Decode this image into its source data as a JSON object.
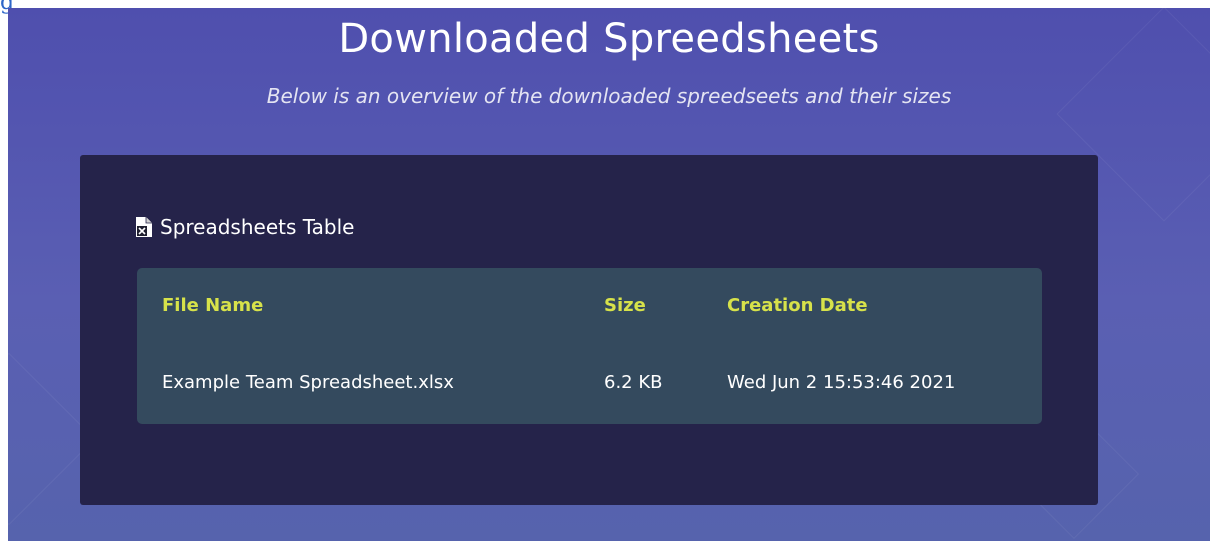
{
  "top_link": "g",
  "page": {
    "title": "Downloaded Spreedsheets",
    "subtitle": "Below is an overview of the downloaded spreedseets and their sizes"
  },
  "card": {
    "icon": "excel-file-icon",
    "title": "Spreadsheets Table"
  },
  "table": {
    "headers": [
      "File Name",
      "Size",
      "Creation Date"
    ],
    "rows": [
      [
        "Example Team Spreadsheet.xlsx",
        "6.2 KB",
        "Wed Jun 2 15:53:46 2021"
      ]
    ]
  },
  "colors": {
    "background_gradient_start": "#4f4fae",
    "background_gradient_end": "#5663ad",
    "card_background": "#25234a",
    "table_background": "#344a5e",
    "header_text": "#d7e24a",
    "body_text": "#ffffff"
  }
}
